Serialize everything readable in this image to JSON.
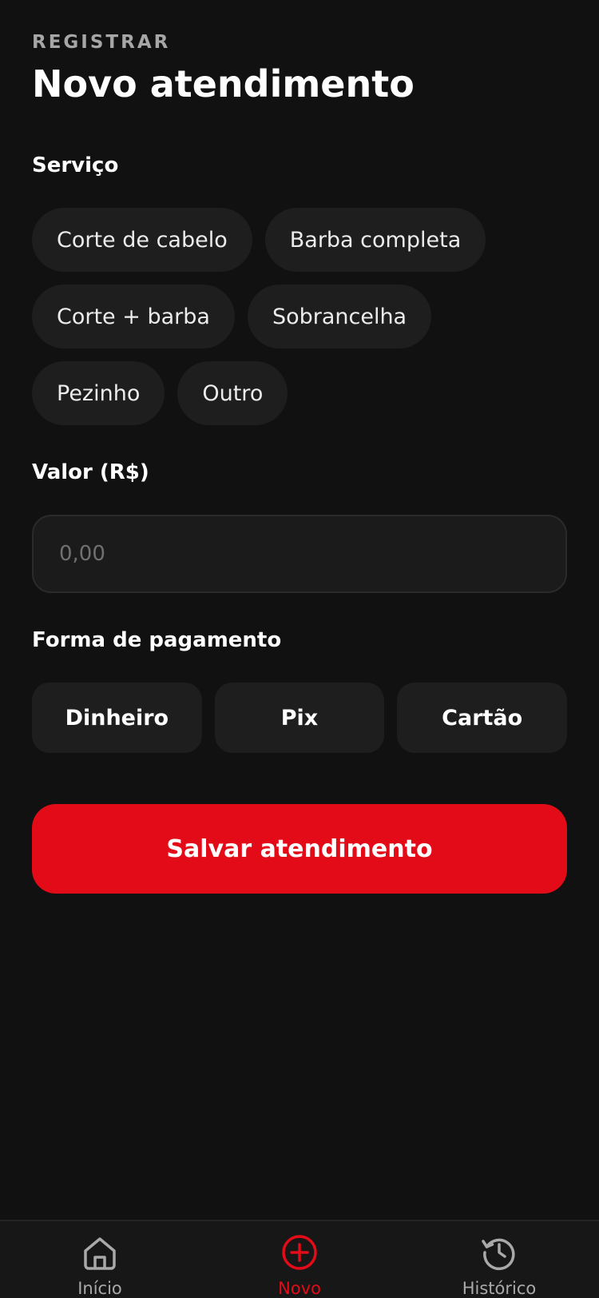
{
  "header": {
    "eyebrow": "REGISTRAR",
    "title": "Novo atendimento"
  },
  "service": {
    "label": "Serviço",
    "options": [
      "Corte de cabelo",
      "Barba completa",
      "Corte + barba",
      "Sobrancelha",
      "Pezinho",
      "Outro"
    ]
  },
  "value": {
    "label": "Valor (R$)",
    "current": "",
    "placeholder": "0,00"
  },
  "payment": {
    "label": "Forma de pagamento",
    "options": [
      "Dinheiro",
      "Pix",
      "Cartão"
    ]
  },
  "save_button": {
    "label": "Salvar atendimento"
  },
  "bottom_nav": {
    "items": [
      {
        "label": "Início",
        "icon": "home-icon"
      },
      {
        "label": "Novo",
        "icon": "plus-circle-icon",
        "active": true
      },
      {
        "label": "Histórico",
        "icon": "history-icon"
      }
    ]
  },
  "colors": {
    "background": "#111112",
    "surface": "#1e1e1f",
    "accent": "#e30b17",
    "muted_text": "#a6a6a6"
  }
}
